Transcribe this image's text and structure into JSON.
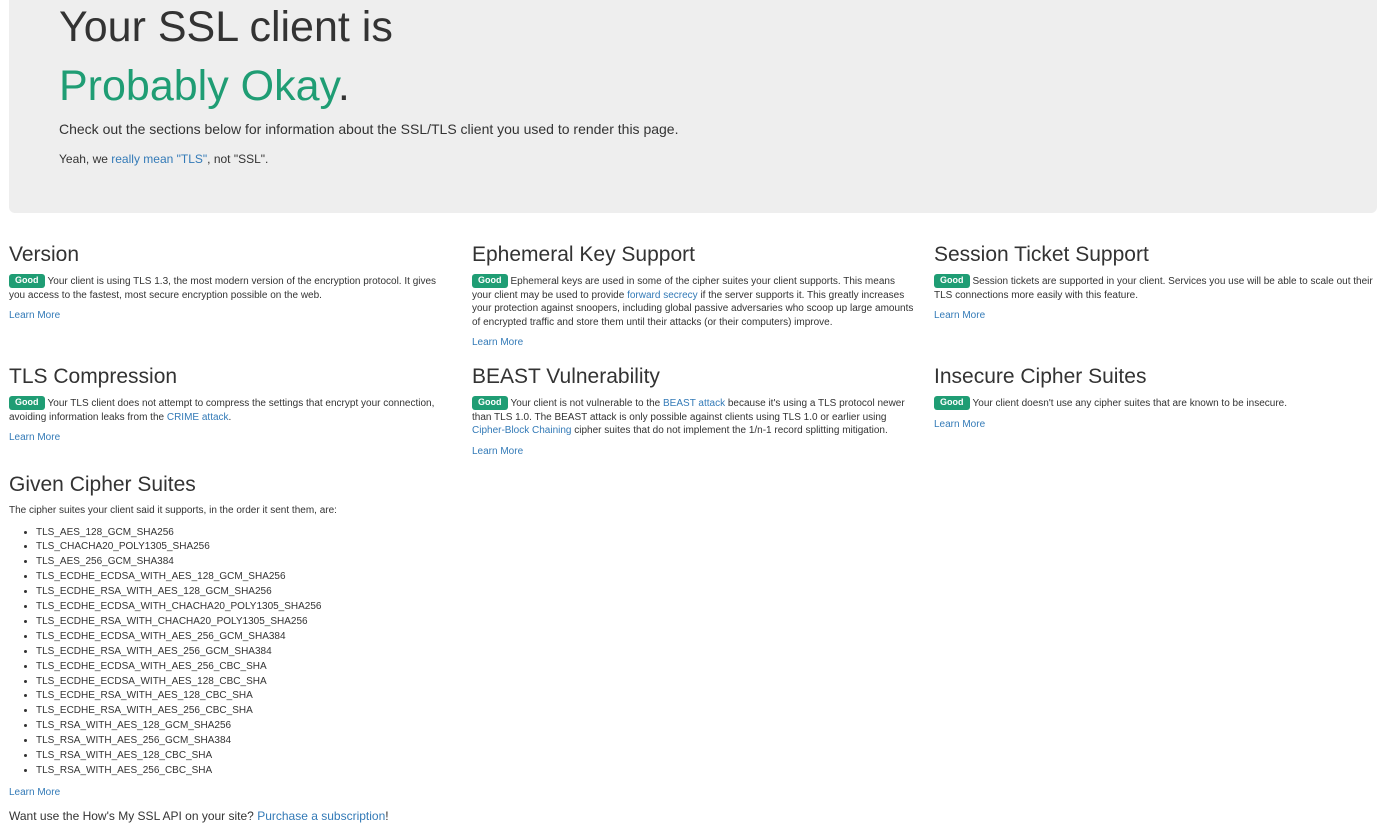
{
  "hero": {
    "headline": "Your SSL client is",
    "rating": "Probably Okay",
    "rating_suffix": ".",
    "lead": "Check out the sections below for information about the SSL/TLS client you used to render this page.",
    "tls_note_prefix": "Yeah, we ",
    "tls_note_link": "really mean \"TLS\"",
    "tls_note_suffix": ", not \"SSL\"."
  },
  "colors": {
    "good": "#1f9d74",
    "link": "#337ab7",
    "jumbotron_bg": "#eeeeee"
  },
  "sections": {
    "version": {
      "title": "Version",
      "badge": "Good",
      "text": "Your client is using TLS 1.3, the most modern version of the encryption protocol. It gives you access to the fastest, most secure encryption possible on the web.",
      "learn_more": "Learn More"
    },
    "ephemeral": {
      "title": "Ephemeral Key Support",
      "badge": "Good",
      "text_a": "Ephemeral keys are used in some of the cipher suites your client supports. This means your client may be used to provide ",
      "link": "forward secrecy",
      "text_b": " if the server supports it. This greatly increases your protection against snoopers, including global passive adversaries who scoop up large amounts of encrypted traffic and store them until their attacks (or their computers) improve.",
      "learn_more": "Learn More"
    },
    "session_ticket": {
      "title": "Session Ticket Support",
      "badge": "Good",
      "text": "Session tickets are supported in your client. Services you use will be able to scale out their TLS connections more easily with this feature.",
      "learn_more": "Learn More"
    },
    "compression": {
      "title": "TLS Compression",
      "badge": "Good",
      "text_a": "Your TLS client does not attempt to compress the settings that encrypt your connection, avoiding information leaks from the ",
      "link": "CRIME attack",
      "text_b": ".",
      "learn_more": "Learn More"
    },
    "beast": {
      "title": "BEAST Vulnerability",
      "badge": "Good",
      "text_a": "Your client is not vulnerable to the ",
      "link_a": "BEAST attack",
      "text_b": " because it's using a TLS protocol newer than TLS 1.0. The BEAST attack is only possible against clients using TLS 1.0 or earlier using ",
      "link_b": "Cipher-Block Chaining",
      "text_c": " cipher suites that do not implement the 1/n-1 record splitting mitigation.",
      "learn_more": "Learn More"
    },
    "insecure": {
      "title": "Insecure Cipher Suites",
      "badge": "Good",
      "text": "Your client doesn't use any cipher suites that are known to be insecure.",
      "learn_more": "Learn More"
    },
    "given": {
      "title": "Given Cipher Suites",
      "intro": "The cipher suites your client said it supports, in the order it sent them, are:",
      "suites": [
        "TLS_AES_128_GCM_SHA256",
        "TLS_CHACHA20_POLY1305_SHA256",
        "TLS_AES_256_GCM_SHA384",
        "TLS_ECDHE_ECDSA_WITH_AES_128_GCM_SHA256",
        "TLS_ECDHE_RSA_WITH_AES_128_GCM_SHA256",
        "TLS_ECDHE_ECDSA_WITH_CHACHA20_POLY1305_SHA256",
        "TLS_ECDHE_RSA_WITH_CHACHA20_POLY1305_SHA256",
        "TLS_ECDHE_ECDSA_WITH_AES_256_GCM_SHA384",
        "TLS_ECDHE_RSA_WITH_AES_256_GCM_SHA384",
        "TLS_ECDHE_ECDSA_WITH_AES_256_CBC_SHA",
        "TLS_ECDHE_ECDSA_WITH_AES_128_CBC_SHA",
        "TLS_ECDHE_RSA_WITH_AES_128_CBC_SHA",
        "TLS_ECDHE_RSA_WITH_AES_256_CBC_SHA",
        "TLS_RSA_WITH_AES_128_GCM_SHA256",
        "TLS_RSA_WITH_AES_256_GCM_SHA384",
        "TLS_RSA_WITH_AES_128_CBC_SHA",
        "TLS_RSA_WITH_AES_256_CBC_SHA"
      ],
      "learn_more": "Learn More"
    }
  },
  "footer": {
    "prefix": "Want use the How's My SSL API on your site? ",
    "link": "Purchase a subscription",
    "suffix": "!"
  }
}
